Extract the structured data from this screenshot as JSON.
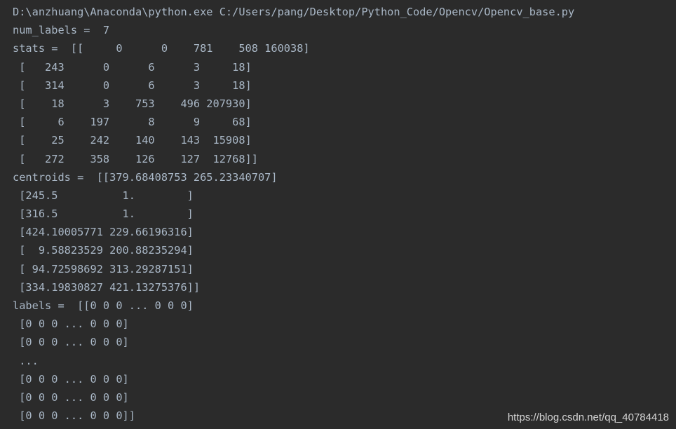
{
  "console": {
    "lines": [
      "D:\\anzhuang\\Anaconda\\python.exe C:/Users/pang/Desktop/Python_Code/Opencv/Opencv_base.py",
      "num_labels =  7",
      "stats =  [[     0      0    781    508 160038]",
      " [   243      0      6      3     18]",
      " [   314      0      6      3     18]",
      " [    18      3    753    496 207930]",
      " [     6    197      8      9     68]",
      " [    25    242    140    143  15908]",
      " [   272    358    126    127  12768]]",
      "centroids =  [[379.68408753 265.23340707]",
      " [245.5          1.        ]",
      " [316.5          1.        ]",
      " [424.10005771 229.66196316]",
      " [  9.58823529 200.88235294]",
      " [ 94.72598692 313.29287151]",
      " [334.19830827 421.13275376]]",
      "labels =  [[0 0 0 ... 0 0 0]",
      " [0 0 0 ... 0 0 0]",
      " [0 0 0 ... 0 0 0]",
      " ...",
      " [0 0 0 ... 0 0 0]",
      " [0 0 0 ... 0 0 0]",
      " [0 0 0 ... 0 0 0]]"
    ]
  },
  "watermark": {
    "text": "https://blog.csdn.net/qq_40784418"
  },
  "colors": {
    "background": "#2b2b2b",
    "text": "#a9b7c6"
  }
}
